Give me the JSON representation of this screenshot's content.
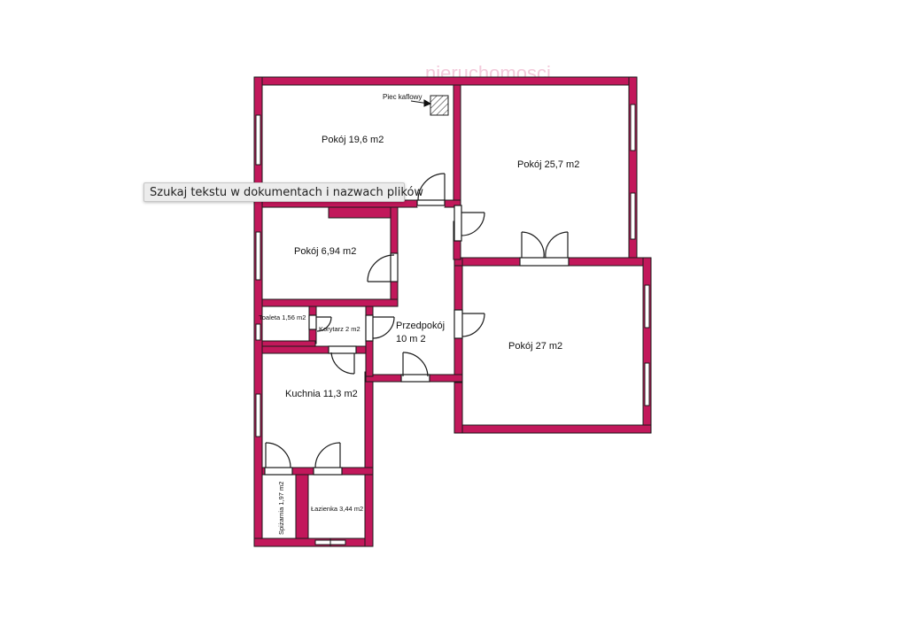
{
  "colors": {
    "wall": "#c2185b",
    "wall_stroke": "#1a1a1a",
    "background": "#ffffff"
  },
  "watermark": "nieruchomosci",
  "tooltip": {
    "text": "Szukaj tekstu w dokumentach i nazwach plików"
  },
  "stove": {
    "label": "Piec kaflowy"
  },
  "rooms": {
    "pokoj_19_6": "Pokój 19,6 m2",
    "pokoj_25_7": "Pokój 25,7 m2",
    "pokoj_6_94": "Pokój 6,94 m2",
    "pokoj_27": "Pokój 27 m2",
    "przedpokoj_line1": "Przedpokój",
    "przedpokoj_line2": "10 m 2",
    "toaleta": "Toaleta 1,56 m2",
    "korytarz": "Korytarz 2 m2",
    "kuchnia": "Kuchnia 11,3 m2",
    "spizarnia": "Spiżarnia 1,97 m2",
    "lazienka": "Łazienka 3,44 m2"
  }
}
